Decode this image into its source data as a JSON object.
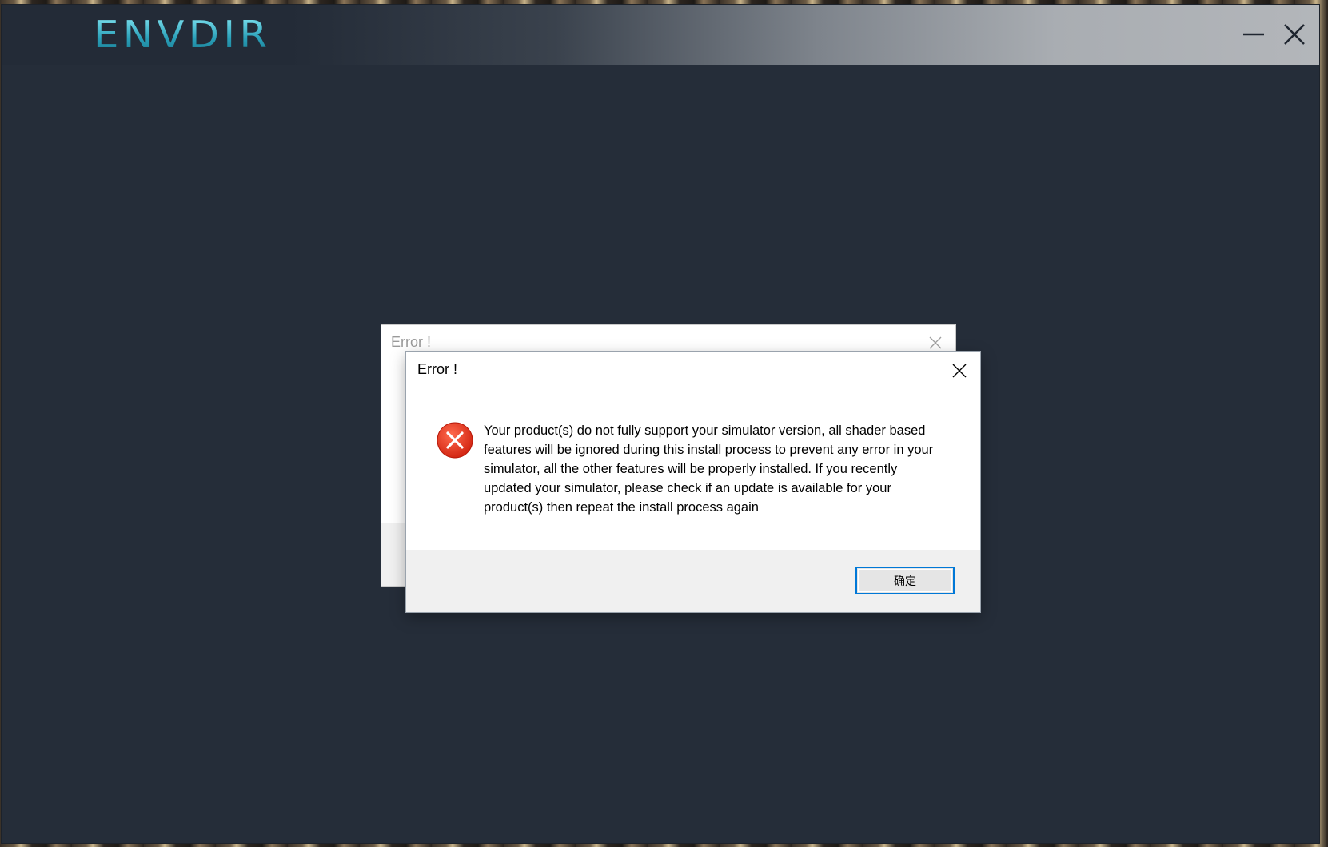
{
  "app": {
    "logo_text": "ENVDIR",
    "controls": {
      "minimize_icon": "minimize-icon",
      "close_icon": "close-icon"
    },
    "colors": {
      "window_bg": "#252d39",
      "logo": "#3fb1c6"
    }
  },
  "background_dialog": {
    "title": "Error !",
    "close_icon": "close-icon"
  },
  "dialog": {
    "title": "Error !",
    "close_icon": "close-icon",
    "icon": "error-icon",
    "icon_color": "#e0311e",
    "message": "Your product(s) do not fully support your simulator version, all shader based features will be ignored during this install process to prevent any error in your simulator, all the other features will be properly installed. If you recently updated your simulator, please check if an update is available for your product(s) then repeat the install process again",
    "ok_label": "确定",
    "button_border_color": "#0078d7"
  }
}
